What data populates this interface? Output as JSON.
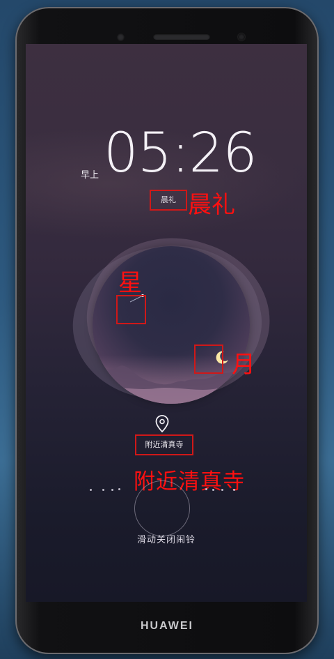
{
  "device": {
    "brand": "HUAWEI"
  },
  "alarm": {
    "ampm": "早上",
    "time": "05:26",
    "label": "晨礼",
    "location": "附近清真寺",
    "dismiss_hint": "滑动关闭闹铃"
  },
  "annotations": {
    "label_callout": "晨礼",
    "star_callout": "星",
    "moon_callout": "月",
    "location_callout": "附近清真寺"
  },
  "colors": {
    "annotation_red": "#ff1010",
    "screen_top": "#3d2f40",
    "screen_bottom": "#171827",
    "text": "#f4f1f6"
  },
  "icons": {
    "location": "map-pin-icon",
    "star": "shooting-star-icon",
    "moon": "crescent-moon-icon"
  }
}
